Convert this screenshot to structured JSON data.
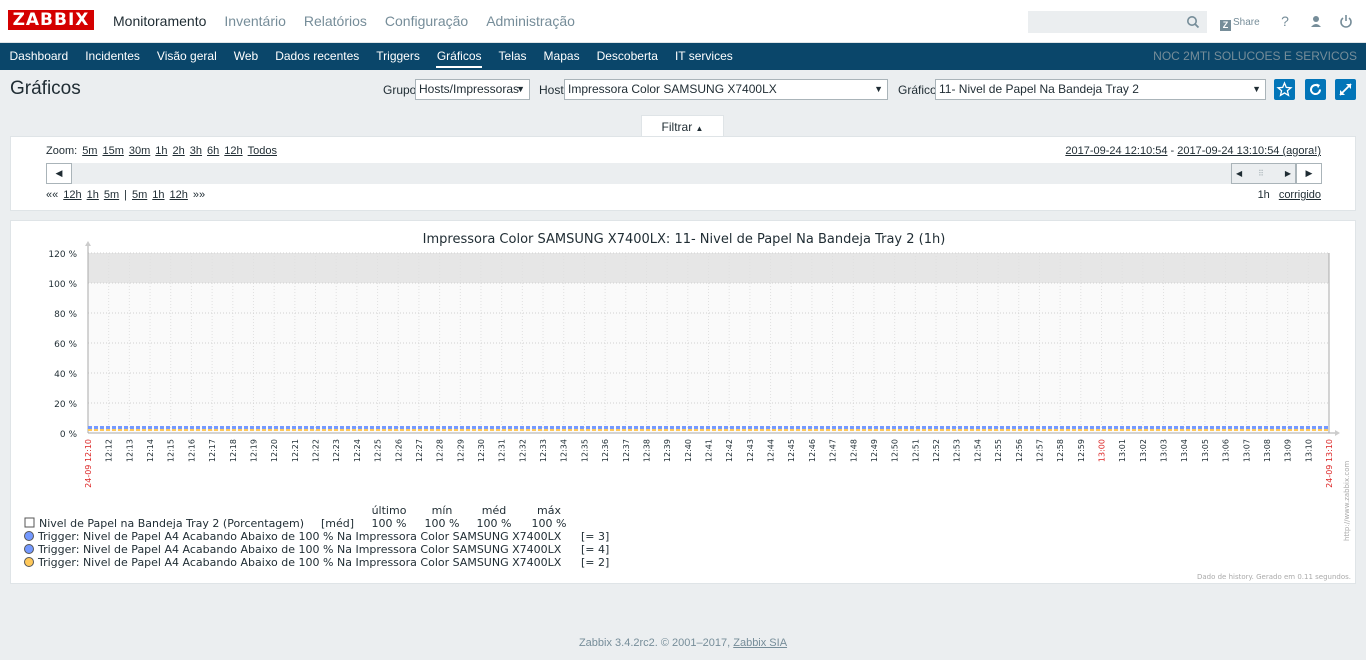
{
  "header": {
    "logo": "ZABBIX",
    "menu": [
      "Monitoramento",
      "Inventário",
      "Relatórios",
      "Configuração",
      "Administração"
    ],
    "search_value": "",
    "share_label": "Share",
    "help_icon": "?",
    "user_icon": "user-icon",
    "logout_icon": "power-icon"
  },
  "subnav": {
    "items": [
      "Dashboard",
      "Incidentes",
      "Visão geral",
      "Web",
      "Dados recentes",
      "Triggers",
      "Gráficos",
      "Telas",
      "Mapas",
      "Descoberta",
      "IT services"
    ],
    "selected": "Gráficos",
    "server_name": "NOC 2MTI SOLUCOES E SERVICOS"
  },
  "page": {
    "title": "Gráficos",
    "group_label": "Grupo",
    "group_value": "Hosts/Impressoras",
    "host_label": "Host",
    "host_value": "Impressora Color SAMSUNG X7400LX",
    "graph_label": "Gráfico",
    "graph_value": "11- Nivel de Papel Na Bandeja Tray 2",
    "colors": {
      "accent": "#0275b8",
      "nav_bg": "#0a466a",
      "logo": "#d40000"
    }
  },
  "filter": {
    "tab_label": "Filtrar",
    "zoom_label": "Zoom:",
    "zoom_options": [
      "5m",
      "15m",
      "30m",
      "1h",
      "2h",
      "3h",
      "6h",
      "12h",
      "Todos"
    ],
    "period_from": "2017-09-24 12:10:54",
    "period_sep": " - ",
    "period_to": "2017-09-24 13:10:54 (agora!)",
    "nav_back_marker": "««",
    "nav_back": [
      "12h",
      "1h",
      "5m"
    ],
    "nav_sep": "|",
    "nav_fwd": [
      "5m",
      "1h",
      "12h"
    ],
    "nav_fwd_marker": "»»",
    "period_length": "1h",
    "fixed_label": "corrigido"
  },
  "chart_data": {
    "type": "line",
    "title": "Impressora Color SAMSUNG X7400LX: 11- Nivel de Papel Na Bandeja Tray 2 (1h)",
    "yticks": [
      "0 %",
      "20 %",
      "40 %",
      "60 %",
      "80 %",
      "100 %",
      "120 %"
    ],
    "ylim": [
      0,
      120
    ],
    "x_start_label": "24-09 12:10",
    "x_end_label": "24-09 13:10",
    "xticks": [
      "12:12",
      "12:13",
      "12:14",
      "12:15",
      "12:16",
      "12:17",
      "12:18",
      "12:19",
      "12:20",
      "12:21",
      "12:22",
      "12:23",
      "12:24",
      "12:25",
      "12:26",
      "12:27",
      "12:28",
      "12:29",
      "12:30",
      "12:31",
      "12:32",
      "12:33",
      "12:34",
      "12:35",
      "12:36",
      "12:37",
      "12:38",
      "12:39",
      "12:40",
      "12:41",
      "12:42",
      "12:43",
      "12:44",
      "12:45",
      "12:46",
      "12:47",
      "12:48",
      "12:49",
      "12:50",
      "12:51",
      "12:52",
      "12:53",
      "12:54",
      "12:55",
      "12:56",
      "12:57",
      "12:58",
      "12:59",
      "13:00",
      "13:01",
      "13:02",
      "13:03",
      "13:04",
      "13:05",
      "13:06",
      "13:07",
      "13:08",
      "13:09",
      "13:10"
    ],
    "highlight_tick": "13:00",
    "series": [
      {
        "name": "Nivel de Papel na Bandeja Tray 2 (Porcentagem)",
        "func": "[méd]",
        "last": "100 %",
        "min": "100 %",
        "avg": "100 %",
        "max": "100 %",
        "color": "#ffffff"
      }
    ],
    "stat_headers": [
      "último",
      "mín",
      "méd",
      "máx"
    ],
    "triggers": [
      {
        "label": "Trigger: Nivel de Papel A4 Acabando Abaixo de 100 %",
        "host": "Na Impressora Color SAMSUNG X7400LX",
        "value": "[= 3]",
        "color": "#7499ff"
      },
      {
        "label": "Trigger: Nivel de Papel A4 Acabando Abaixo de 100 %",
        "host": "Na Impressora Color SAMSUNG X7400LX",
        "value": "[= 4]",
        "color": "#7499ff"
      },
      {
        "label": "Trigger: Nivel de Papel A4 Acabando Abaixo de 100 %",
        "host": "Na Impressora Color SAMSUNG X7400LX",
        "value": "[= 2]",
        "color": "#ffc859"
      }
    ],
    "trigger_line_values": [
      3,
      4,
      2
    ],
    "side_text": "http://www.zabbix.com",
    "footnote": "Dado de history. Gerado em 0.11 segundos."
  },
  "footer": {
    "text": "Zabbix 3.4.2rc2. © 2001–2017,",
    "link": "Zabbix SIA"
  }
}
